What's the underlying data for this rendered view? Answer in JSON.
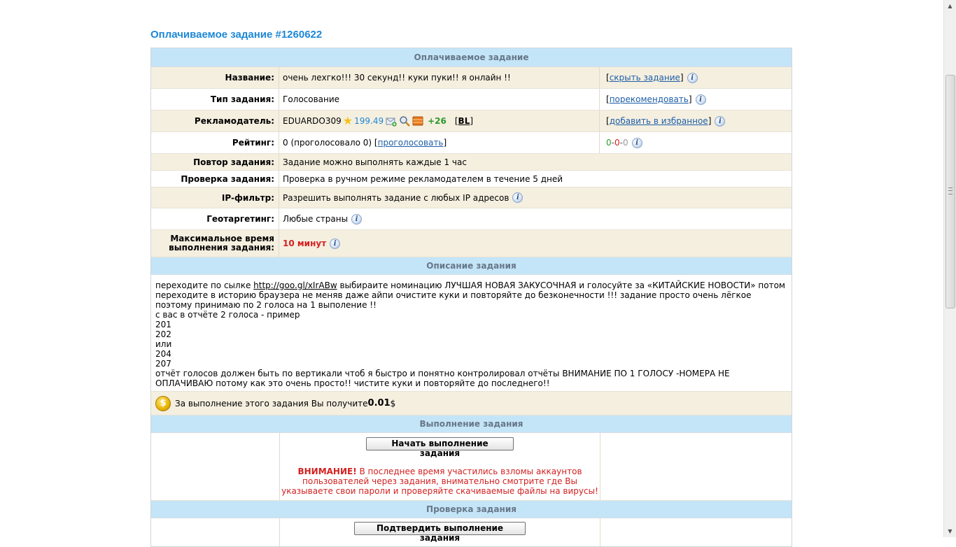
{
  "page_title": "Оплачиваемое задание #1260622",
  "section_task": "Оплачиваемое задание",
  "rows": {
    "name": {
      "label": "Название:",
      "value": "очень лехгко!!! 30 секунд!! куки пуки!! я онлайн !!",
      "action": "скрыть задание"
    },
    "type": {
      "label": "Тип задания:",
      "value": "Голосование",
      "action": "порекомендовать"
    },
    "advertiser": {
      "label": "Рекламодатель:",
      "user": "EDUARDO309",
      "money": "199.49",
      "plus": "+26",
      "bl": "BL",
      "action": "добавить в избранное"
    },
    "rating": {
      "label": "Рейтинг:",
      "value": "0 (проголосовало 0) [",
      "vote_link": "проголосовать",
      "value_end": "]",
      "r1": "0",
      "r2": "0",
      "r3": "0",
      "sep": " - "
    },
    "repeat": {
      "label": "Повтор задания:",
      "value": "Задание можно выполнять каждые 1 час"
    },
    "check": {
      "label": "Проверка задания:",
      "value": "Проверка в ручном режиме рекламодателем в течение 5 дней"
    },
    "ip": {
      "label": "IP-фильтр:",
      "value": "Разрешить выполнять задание с любых IP адресов"
    },
    "geo": {
      "label": "Геотаргетинг:",
      "value": "Любые страны"
    },
    "maxtime": {
      "label_1": "Максимальное время",
      "label_2": "выполнения задания:",
      "value": "10 минут"
    }
  },
  "section_desc": "Описание задания",
  "description": {
    "p1_a": "переходите по сылке ",
    "p1_link": "http://goo.gl/xIrABw",
    "p1_b": " выбираите номинацию ЛУЧШАЯ НОВАЯ ЗАКУСОЧНАЯ и голосуйте за «КИТАЙСКИЕ НОВОСТИ» потом переходите в историю браузера не меняв даже айпи очистите куки и повторяйте до безконечности !!! задание просто очень лёгкое поэтому принимаю по 2 голоса на 1 выполение !!",
    "l2": "с вас в отчёте 2 голоса - пример",
    "l3": "201",
    "l4": "202",
    "l5": "или",
    "l6": "204",
    "l7": "207",
    "l8": "отчёт голосов должен быть по вертикали чтоб я быстро и понятно контролировал отчёты ВНИМАНИЕ ПО 1 ГОЛОСУ -НОМЕРА НЕ ОПЛАЧИВАЮ потому как это очень просто!! чистите куки и повторяйте до последнего!!"
  },
  "reward": {
    "text": "За выполнение этого задания Вы получите ",
    "amount": "0.01",
    "currency": "$",
    "coin": "$"
  },
  "section_exec": "Выполнение задания",
  "start_button": "Начать выполнение задания",
  "warning": {
    "title": "ВНИМАНИЕ!",
    "text": " В последнее время участились взломы аккаунтов пользователей через задания, внимательно смотрите где Вы указываете свои пароли и проверяйте скачиваемые файлы на вирусы!"
  },
  "section_verify": "Проверка задания",
  "confirm_button": "Подтвердить выполнение задания",
  "icons": {
    "info": "info-icon",
    "star": "star-icon",
    "mail": "mail-add-icon",
    "search": "magnifier-icon",
    "box": "box-icon",
    "coin": "coin-icon"
  }
}
